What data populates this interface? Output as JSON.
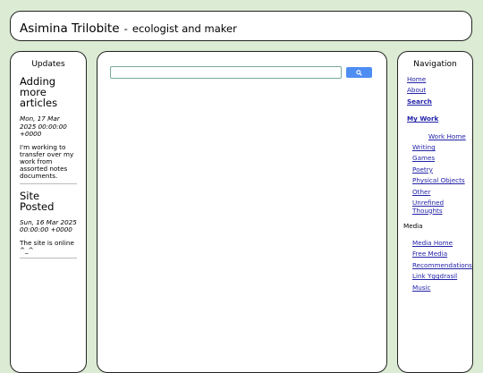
{
  "header": {
    "site_name": "Asimina Trilobite",
    "separator": "-",
    "tagline": "ecologist and maker"
  },
  "updates": {
    "heading": "Updates",
    "posts": [
      {
        "title": "Adding more articles",
        "date": "Mon, 17 Mar 2025 00:00:00 +0000",
        "body": "I'm working to transfer over my work from assorted notes documents."
      },
      {
        "title": "Site Posted",
        "date": "Sun, 16 Mar 2025 00:00:00 +0000",
        "body": "The site is online ^_^"
      }
    ]
  },
  "search": {
    "value": "",
    "button_icon": "search-icon",
    "button_color": "#4e8ef3"
  },
  "nav": {
    "heading": "Navigation",
    "top_links": [
      "Home",
      "About",
      "Search"
    ],
    "my_work": "My Work",
    "work_home": "Work Home",
    "work_links": [
      "Writing",
      "Games",
      "Poetry",
      "Physical Objects",
      "Other",
      "Unrefined Thoughts"
    ],
    "media_heading": "Media",
    "media_links": [
      "Media Home",
      "Free Media",
      "Recommendations",
      "Link Yggdrasil",
      "Music"
    ]
  },
  "colors": {
    "background": "#dcecd4",
    "link": "#2323a8"
  }
}
